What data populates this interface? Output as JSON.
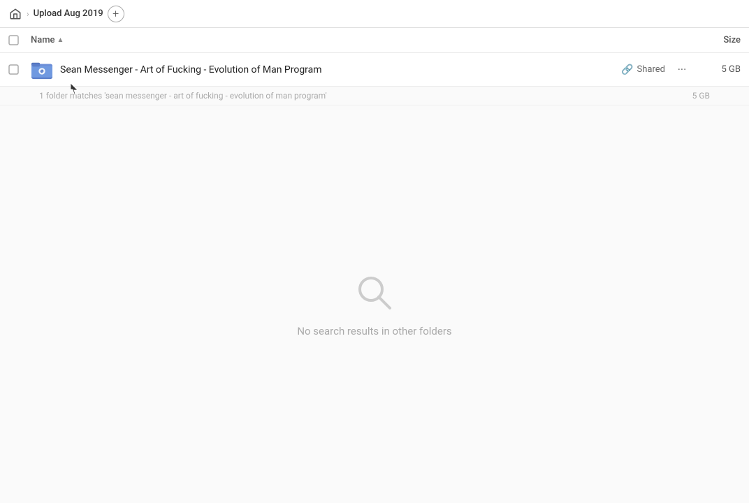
{
  "breadcrumb": {
    "folder": "Upload Aug 2019",
    "home_label": "home"
  },
  "add_button_label": "+",
  "columns": {
    "name_label": "Name",
    "size_label": "Size"
  },
  "file_row": {
    "name": "Sean Messenger - Art of Fucking - Evolution of Man Program",
    "shared_label": "Shared",
    "size": "5 GB",
    "more_dots": "···"
  },
  "match_count": {
    "text": "1 folder matches 'sean messenger - art of fucking - evolution of man program'",
    "size": "5 GB"
  },
  "empty_state": {
    "text": "No search results in other folders"
  }
}
